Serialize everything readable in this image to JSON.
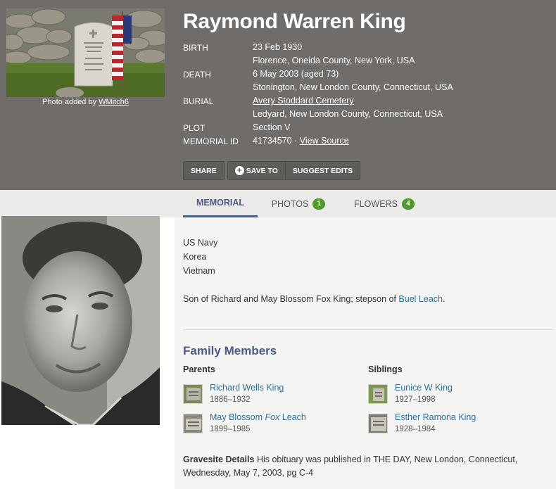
{
  "header": {
    "name": "Raymond Warren King",
    "photo_credit_prefix": "Photo added by",
    "photo_credit_user": "WMitch6",
    "facts": {
      "birth_label": "BIRTH",
      "birth_date": "23 Feb 1930",
      "birth_place": "Florence, Oneida County, New York, USA",
      "death_label": "DEATH",
      "death_date": "6 May 2003 (aged 73)",
      "death_place": "Stonington, New London County, Connecticut, USA",
      "burial_label": "BURIAL",
      "burial_cemetery": "Avery Stoddard Cemetery",
      "burial_place": "Ledyard, New London County, Connecticut, USA",
      "plot_label": "PLOT",
      "plot_value": "Section V",
      "memorial_id_label": "MEMORIAL ID",
      "memorial_id_value": "41734570",
      "memorial_id_sep": "·",
      "view_source": "View Source"
    },
    "actions": {
      "share": "SHARE",
      "save_to": "SAVE TO",
      "suggest_edits": "SUGGEST EDITS"
    }
  },
  "tabs": [
    {
      "label": "MEMORIAL",
      "active": true
    },
    {
      "label": "PHOTOS",
      "count": "1"
    },
    {
      "label": "FLOWERS",
      "count": "4"
    }
  ],
  "bio": {
    "lines": [
      "US Navy",
      "Korea",
      "Vietnam"
    ],
    "son_of_text": "Son of Richard and May Blossom Fox King; stepson of",
    "stepson_link": "Buel Leach",
    "son_of_end": "."
  },
  "family": {
    "heading": "Family Members",
    "parents_heading": "Parents",
    "siblings_heading": "Siblings",
    "parents": [
      {
        "name": "Richard Wells King",
        "dates": "1886–1932"
      },
      {
        "name_pre": "May Blossom ",
        "name_italic": "Fox",
        "name_post": " Leach",
        "dates": "1899–1985"
      }
    ],
    "siblings": [
      {
        "name": "Eunice W King",
        "dates": "1927–1998"
      },
      {
        "name": "Esther Ramona King",
        "dates": "1928–1984"
      }
    ]
  },
  "gravesite": {
    "label": "Gravesite Details",
    "text": "His obituary was published in THE DAY, New London, Connecticut, Wednesday, May 7, 2003, pg C-4"
  },
  "colors": {
    "header_bg": "#6f6c69",
    "accent": "#4b5b8a",
    "link": "#2a6fa0",
    "badge": "#4e9a2e"
  }
}
